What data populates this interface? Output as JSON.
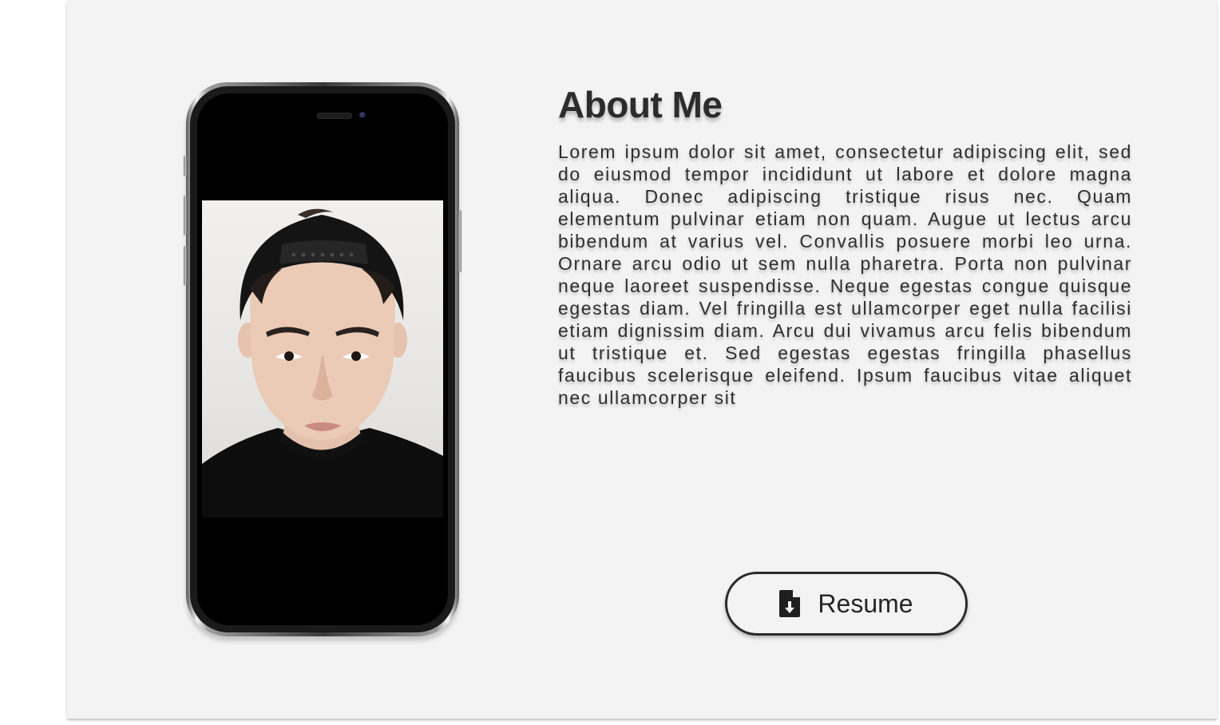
{
  "about": {
    "title": "About Me",
    "bio": "Lorem ipsum dolor sit amet, consectetur adipiscing elit, sed do eiusmod tempor incididunt ut labore et dolore magna aliqua. Donec adipiscing tristique risus nec. Quam elementum pulvinar etiam non quam. Augue ut lectus arcu bibendum at varius vel. Convallis posuere morbi leo urna. Ornare arcu odio ut sem nulla pharetra. Porta non pulvinar neque laoreet suspendisse. Neque egestas congue quisque egestas diam. Vel fringilla est ullamcorper eget nulla facilisi etiam dignissim diam. Arcu dui vivamus arcu felis bibendum ut tristique et. Sed egestas egestas fringilla phasellus faucibus scelerisque eleifend. Ipsum faucibus vitae aliquet nec ullamcorper sit"
  },
  "resume_button": {
    "label": "Resume",
    "icon": "file-download-icon"
  },
  "phone": {
    "icon": "smartphone-mockup",
    "photo": "profile-portrait"
  },
  "colors": {
    "card_background": "#f3f3f3",
    "text": "#2c2c2c",
    "button_border": "#2b2b2b"
  }
}
